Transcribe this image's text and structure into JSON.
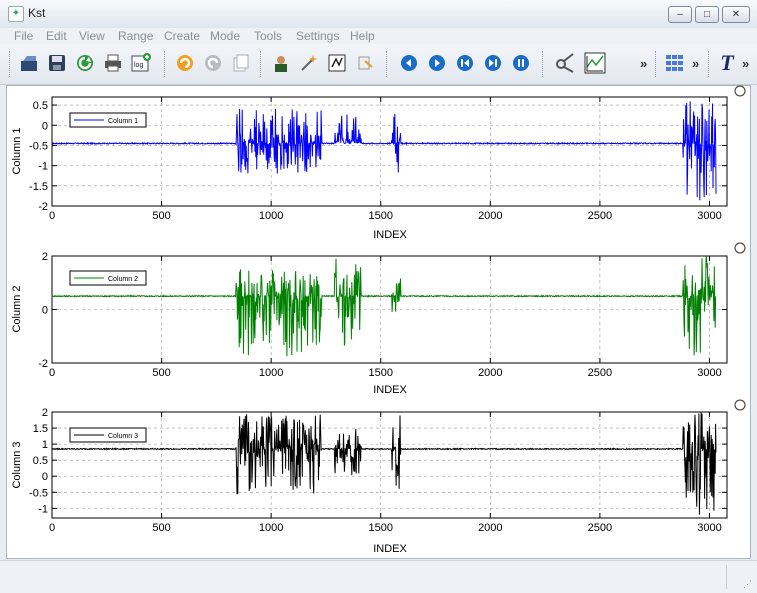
{
  "window": {
    "title": "Kst",
    "minimize_label": "–",
    "maximize_label": "□",
    "close_label": "✕"
  },
  "menu": [
    "File",
    "Edit",
    "View",
    "Range",
    "Create",
    "Mode",
    "Tools",
    "Settings",
    "Help"
  ],
  "toolbar": {
    "icons": [
      "open-icon",
      "save-icon",
      "reload-icon",
      "print-icon",
      "export-log-icon",
      "undo-icon",
      "redo-icon",
      "copy-icon",
      "data-manager-icon",
      "wizard-icon",
      "edit-icon",
      "plugin-icon",
      "back-icon",
      "forward-icon",
      "rewind-icon",
      "skip-icon",
      "pause-icon",
      "zoom-mode-icon",
      "plot-mode-icon",
      "layout-icon",
      "text-icon"
    ],
    "overflow_label": "»"
  },
  "chart_data": [
    {
      "type": "line",
      "ylabel": "Column 1",
      "xlabel": "INDEX",
      "xlim": [
        0,
        3080
      ],
      "ylim": [
        -2,
        0.7
      ],
      "x_ticks": [
        "0",
        "500",
        "1000",
        "1500",
        "2000",
        "2500",
        "3000"
      ],
      "y_ticks": [
        "0.5",
        "0",
        "-0.5",
        "-1",
        "-1.5",
        "-2"
      ],
      "series": [
        {
          "name": "Column 1",
          "color": "#0000ff",
          "baseline": -0.45,
          "bursts": [
            [
              840,
              1230,
              0.45,
              -1.2
            ],
            [
              1290,
              1410,
              0.3,
              -0.3
            ],
            [
              1550,
              1590,
              0.3,
              -1.2
            ],
            [
              2880,
              3040,
              0.6,
              -2.0
            ]
          ]
        }
      ],
      "grid": true
    },
    {
      "type": "line",
      "ylabel": "Column 2",
      "xlabel": "INDEX",
      "xlim": [
        0,
        3080
      ],
      "ylim": [
        -2,
        2
      ],
      "x_ticks": [
        "0",
        "500",
        "1000",
        "1500",
        "2000",
        "2500",
        "3000"
      ],
      "y_ticks": [
        "2",
        "0",
        "-2"
      ],
      "series": [
        {
          "name": "Column 2",
          "color": "#008000",
          "baseline": 0.5,
          "bursts": [
            [
              840,
              1230,
              1.5,
              -1.9
            ],
            [
              1290,
              1410,
              1.9,
              -1.5
            ],
            [
              1550,
              1590,
              1.2,
              -0.2
            ],
            [
              2880,
              3040,
              2.0,
              -2.0
            ]
          ]
        }
      ],
      "grid": true
    },
    {
      "type": "line",
      "ylabel": "Column 3",
      "xlabel": "INDEX",
      "xlim": [
        0,
        3080
      ],
      "ylim": [
        -1.3,
        2
      ],
      "x_ticks": [
        "0",
        "500",
        "1000",
        "1500",
        "2000",
        "2500",
        "3000"
      ],
      "y_ticks": [
        "2",
        "1.5",
        "1",
        "0.5",
        "0",
        "-0.5",
        "-1"
      ],
      "series": [
        {
          "name": "Column 3",
          "color": "#000000",
          "baseline": 0.85,
          "bursts": [
            [
              840,
              1230,
              2.0,
              -0.6
            ],
            [
              1290,
              1410,
              1.6,
              0.0
            ],
            [
              1550,
              1590,
              2.0,
              -0.5
            ],
            [
              2880,
              3040,
              2.0,
              -1.2
            ]
          ]
        }
      ],
      "grid": true
    }
  ]
}
